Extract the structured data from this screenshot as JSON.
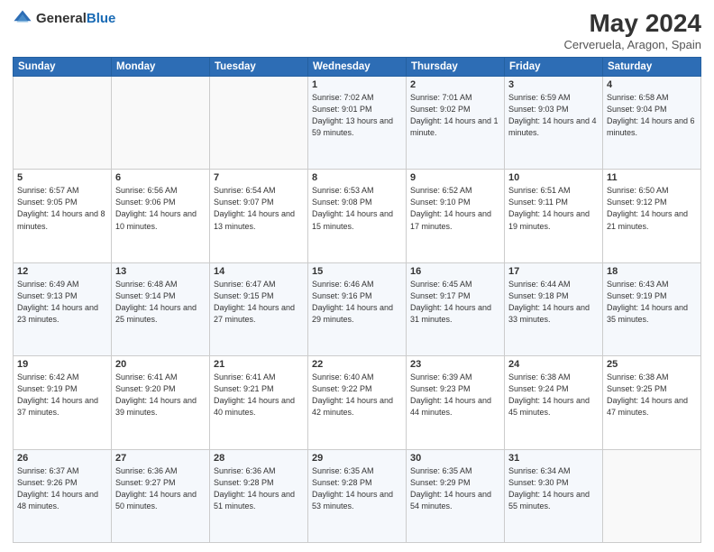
{
  "header": {
    "logo_general": "General",
    "logo_blue": "Blue",
    "title": "May 2024",
    "subtitle": "Cerveruela, Aragon, Spain"
  },
  "weekdays": [
    "Sunday",
    "Monday",
    "Tuesday",
    "Wednesday",
    "Thursday",
    "Friday",
    "Saturday"
  ],
  "weeks": [
    [
      {
        "day": "",
        "sunrise": "",
        "sunset": "",
        "daylight": ""
      },
      {
        "day": "",
        "sunrise": "",
        "sunset": "",
        "daylight": ""
      },
      {
        "day": "",
        "sunrise": "",
        "sunset": "",
        "daylight": ""
      },
      {
        "day": "1",
        "sunrise": "Sunrise: 7:02 AM",
        "sunset": "Sunset: 9:01 PM",
        "daylight": "Daylight: 13 hours and 59 minutes."
      },
      {
        "day": "2",
        "sunrise": "Sunrise: 7:01 AM",
        "sunset": "Sunset: 9:02 PM",
        "daylight": "Daylight: 14 hours and 1 minute."
      },
      {
        "day": "3",
        "sunrise": "Sunrise: 6:59 AM",
        "sunset": "Sunset: 9:03 PM",
        "daylight": "Daylight: 14 hours and 4 minutes."
      },
      {
        "day": "4",
        "sunrise": "Sunrise: 6:58 AM",
        "sunset": "Sunset: 9:04 PM",
        "daylight": "Daylight: 14 hours and 6 minutes."
      }
    ],
    [
      {
        "day": "5",
        "sunrise": "Sunrise: 6:57 AM",
        "sunset": "Sunset: 9:05 PM",
        "daylight": "Daylight: 14 hours and 8 minutes."
      },
      {
        "day": "6",
        "sunrise": "Sunrise: 6:56 AM",
        "sunset": "Sunset: 9:06 PM",
        "daylight": "Daylight: 14 hours and 10 minutes."
      },
      {
        "day": "7",
        "sunrise": "Sunrise: 6:54 AM",
        "sunset": "Sunset: 9:07 PM",
        "daylight": "Daylight: 14 hours and 13 minutes."
      },
      {
        "day": "8",
        "sunrise": "Sunrise: 6:53 AM",
        "sunset": "Sunset: 9:08 PM",
        "daylight": "Daylight: 14 hours and 15 minutes."
      },
      {
        "day": "9",
        "sunrise": "Sunrise: 6:52 AM",
        "sunset": "Sunset: 9:10 PM",
        "daylight": "Daylight: 14 hours and 17 minutes."
      },
      {
        "day": "10",
        "sunrise": "Sunrise: 6:51 AM",
        "sunset": "Sunset: 9:11 PM",
        "daylight": "Daylight: 14 hours and 19 minutes."
      },
      {
        "day": "11",
        "sunrise": "Sunrise: 6:50 AM",
        "sunset": "Sunset: 9:12 PM",
        "daylight": "Daylight: 14 hours and 21 minutes."
      }
    ],
    [
      {
        "day": "12",
        "sunrise": "Sunrise: 6:49 AM",
        "sunset": "Sunset: 9:13 PM",
        "daylight": "Daylight: 14 hours and 23 minutes."
      },
      {
        "day": "13",
        "sunrise": "Sunrise: 6:48 AM",
        "sunset": "Sunset: 9:14 PM",
        "daylight": "Daylight: 14 hours and 25 minutes."
      },
      {
        "day": "14",
        "sunrise": "Sunrise: 6:47 AM",
        "sunset": "Sunset: 9:15 PM",
        "daylight": "Daylight: 14 hours and 27 minutes."
      },
      {
        "day": "15",
        "sunrise": "Sunrise: 6:46 AM",
        "sunset": "Sunset: 9:16 PM",
        "daylight": "Daylight: 14 hours and 29 minutes."
      },
      {
        "day": "16",
        "sunrise": "Sunrise: 6:45 AM",
        "sunset": "Sunset: 9:17 PM",
        "daylight": "Daylight: 14 hours and 31 minutes."
      },
      {
        "day": "17",
        "sunrise": "Sunrise: 6:44 AM",
        "sunset": "Sunset: 9:18 PM",
        "daylight": "Daylight: 14 hours and 33 minutes."
      },
      {
        "day": "18",
        "sunrise": "Sunrise: 6:43 AM",
        "sunset": "Sunset: 9:19 PM",
        "daylight": "Daylight: 14 hours and 35 minutes."
      }
    ],
    [
      {
        "day": "19",
        "sunrise": "Sunrise: 6:42 AM",
        "sunset": "Sunset: 9:19 PM",
        "daylight": "Daylight: 14 hours and 37 minutes."
      },
      {
        "day": "20",
        "sunrise": "Sunrise: 6:41 AM",
        "sunset": "Sunset: 9:20 PM",
        "daylight": "Daylight: 14 hours and 39 minutes."
      },
      {
        "day": "21",
        "sunrise": "Sunrise: 6:41 AM",
        "sunset": "Sunset: 9:21 PM",
        "daylight": "Daylight: 14 hours and 40 minutes."
      },
      {
        "day": "22",
        "sunrise": "Sunrise: 6:40 AM",
        "sunset": "Sunset: 9:22 PM",
        "daylight": "Daylight: 14 hours and 42 minutes."
      },
      {
        "day": "23",
        "sunrise": "Sunrise: 6:39 AM",
        "sunset": "Sunset: 9:23 PM",
        "daylight": "Daylight: 14 hours and 44 minutes."
      },
      {
        "day": "24",
        "sunrise": "Sunrise: 6:38 AM",
        "sunset": "Sunset: 9:24 PM",
        "daylight": "Daylight: 14 hours and 45 minutes."
      },
      {
        "day": "25",
        "sunrise": "Sunrise: 6:38 AM",
        "sunset": "Sunset: 9:25 PM",
        "daylight": "Daylight: 14 hours and 47 minutes."
      }
    ],
    [
      {
        "day": "26",
        "sunrise": "Sunrise: 6:37 AM",
        "sunset": "Sunset: 9:26 PM",
        "daylight": "Daylight: 14 hours and 48 minutes."
      },
      {
        "day": "27",
        "sunrise": "Sunrise: 6:36 AM",
        "sunset": "Sunset: 9:27 PM",
        "daylight": "Daylight: 14 hours and 50 minutes."
      },
      {
        "day": "28",
        "sunrise": "Sunrise: 6:36 AM",
        "sunset": "Sunset: 9:28 PM",
        "daylight": "Daylight: 14 hours and 51 minutes."
      },
      {
        "day": "29",
        "sunrise": "Sunrise: 6:35 AM",
        "sunset": "Sunset: 9:28 PM",
        "daylight": "Daylight: 14 hours and 53 minutes."
      },
      {
        "day": "30",
        "sunrise": "Sunrise: 6:35 AM",
        "sunset": "Sunset: 9:29 PM",
        "daylight": "Daylight: 14 hours and 54 minutes."
      },
      {
        "day": "31",
        "sunrise": "Sunrise: 6:34 AM",
        "sunset": "Sunset: 9:30 PM",
        "daylight": "Daylight: 14 hours and 55 minutes."
      },
      {
        "day": "",
        "sunrise": "",
        "sunset": "",
        "daylight": ""
      }
    ]
  ]
}
